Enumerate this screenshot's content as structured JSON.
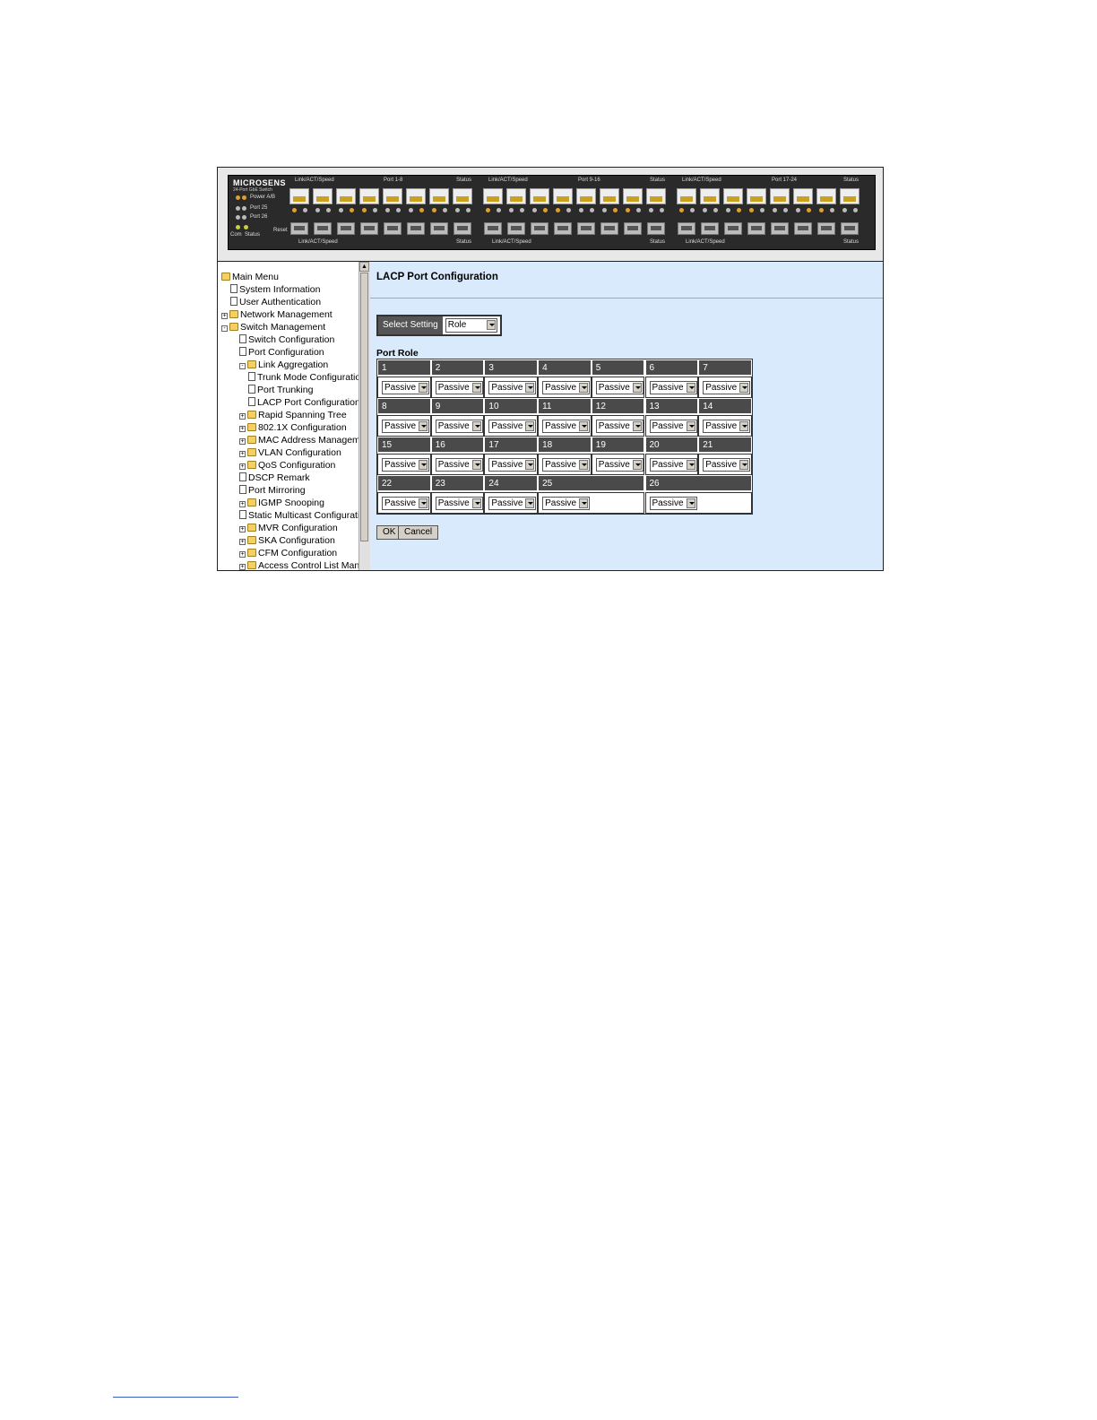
{
  "device": {
    "brand": "MICROSENS",
    "model": "24-Port GbE Switch",
    "labels": {
      "power": "Power A/B",
      "port25": "Port 25",
      "port26": "Port 26",
      "com": "Com",
      "status": "Status",
      "reset": "Reset",
      "group1_top_left": "Link/ACT/Speed",
      "group1_top_mid": "Port 1-8",
      "group1_top_right": "Status",
      "group2_top_left": "Link/ACT/Speed",
      "group2_top_mid": "Port 9-16",
      "group2_top_right": "Status",
      "group3_top_left": "Link/ACT/Speed",
      "group3_top_mid": "Port 17-24",
      "group3_top_right": "Status",
      "group1_bottom_left": "Link/ACT/Speed",
      "group1_bottom_right": "Status",
      "group2_bottom_left": "Link/ACT/Speed",
      "group2_bottom_right": "Status",
      "group3_bottom_left": "Link/ACT/Speed",
      "group3_bottom_right": "Status"
    }
  },
  "sidebar": {
    "items": [
      {
        "label": "Main Menu",
        "type": "folder",
        "pm": ""
      },
      {
        "label": "System Information",
        "type": "doc",
        "pm": ""
      },
      {
        "label": "User Authentication",
        "type": "doc",
        "pm": ""
      },
      {
        "label": "Network Management",
        "type": "folder",
        "pm": "+"
      },
      {
        "label": "Switch Management",
        "type": "folder",
        "pm": "-"
      },
      {
        "label": "Switch Configuration",
        "type": "doc",
        "pm": ""
      },
      {
        "label": "Port Configuration",
        "type": "doc",
        "pm": ""
      },
      {
        "label": "Link Aggregation",
        "type": "folder",
        "pm": "-"
      },
      {
        "label": "Trunk Mode Configuration",
        "type": "doc",
        "pm": ""
      },
      {
        "label": "Port Trunking",
        "type": "doc",
        "pm": ""
      },
      {
        "label": "LACP Port Configuration",
        "type": "doc",
        "pm": ""
      },
      {
        "label": "Rapid Spanning Tree",
        "type": "folder",
        "pm": "+"
      },
      {
        "label": "802.1X Configuration",
        "type": "folder",
        "pm": "+"
      },
      {
        "label": "MAC Address Management",
        "type": "folder",
        "pm": "+"
      },
      {
        "label": "VLAN Configuration",
        "type": "folder",
        "pm": "+"
      },
      {
        "label": "QoS Configuration",
        "type": "folder",
        "pm": "+"
      },
      {
        "label": "DSCP Remark",
        "type": "doc",
        "pm": ""
      },
      {
        "label": "Port Mirroring",
        "type": "doc",
        "pm": ""
      },
      {
        "label": "IGMP Snooping",
        "type": "folder",
        "pm": "+"
      },
      {
        "label": "Static Multicast Configuration",
        "type": "doc",
        "pm": ""
      },
      {
        "label": "MVR Configuration",
        "type": "folder",
        "pm": "+"
      },
      {
        "label": "SKA Configuration",
        "type": "folder",
        "pm": "+"
      },
      {
        "label": "CFM Configuration",
        "type": "folder",
        "pm": "+"
      },
      {
        "label": "Access Control List Management",
        "type": "folder",
        "pm": "+"
      }
    ]
  },
  "main": {
    "title": "LACP Port Configuration",
    "select_setting_label": "Select Setting",
    "select_setting_value": "Role",
    "port_role_title": "Port Role",
    "ports": [
      {
        "port": "1",
        "role": "Passive"
      },
      {
        "port": "2",
        "role": "Passive"
      },
      {
        "port": "3",
        "role": "Passive"
      },
      {
        "port": "4",
        "role": "Passive"
      },
      {
        "port": "5",
        "role": "Passive"
      },
      {
        "port": "6",
        "role": "Passive"
      },
      {
        "port": "7",
        "role": "Passive"
      },
      {
        "port": "8",
        "role": "Passive"
      },
      {
        "port": "9",
        "role": "Passive"
      },
      {
        "port": "10",
        "role": "Passive"
      },
      {
        "port": "11",
        "role": "Passive"
      },
      {
        "port": "12",
        "role": "Passive"
      },
      {
        "port": "13",
        "role": "Passive"
      },
      {
        "port": "14",
        "role": "Passive"
      },
      {
        "port": "15",
        "role": "Passive"
      },
      {
        "port": "16",
        "role": "Passive"
      },
      {
        "port": "17",
        "role": "Passive"
      },
      {
        "port": "18",
        "role": "Passive"
      },
      {
        "port": "19",
        "role": "Passive"
      },
      {
        "port": "20",
        "role": "Passive"
      },
      {
        "port": "21",
        "role": "Passive"
      },
      {
        "port": "22",
        "role": "Passive"
      },
      {
        "port": "23",
        "role": "Passive"
      },
      {
        "port": "24",
        "role": "Passive"
      },
      {
        "port": "25",
        "role": "Passive"
      },
      {
        "port": "26",
        "role": "Passive"
      }
    ],
    "ok_label": "OK",
    "cancel_label": "Cancel"
  }
}
